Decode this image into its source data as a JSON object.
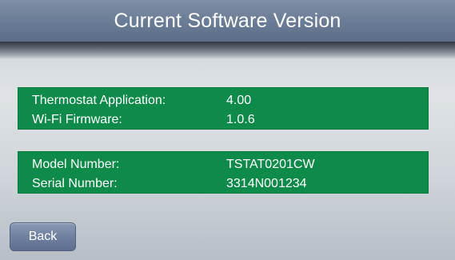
{
  "header": {
    "title": "Current Software Version"
  },
  "software_panel": {
    "rows": [
      {
        "label": "Thermostat Application:",
        "value": "4.00"
      },
      {
        "label": "Wi-Fi Firmware:",
        "value": "1.0.6"
      }
    ]
  },
  "device_panel": {
    "rows": [
      {
        "label": "Model Number:",
        "value": "TSTAT0201CW"
      },
      {
        "label": "Serial Number:",
        "value": "3314N001234"
      }
    ]
  },
  "footer": {
    "back_label": "Back"
  },
  "colors": {
    "title_bar": "#6a7b95",
    "panel_green": "#0e8a4a",
    "text": "#ffffff"
  }
}
